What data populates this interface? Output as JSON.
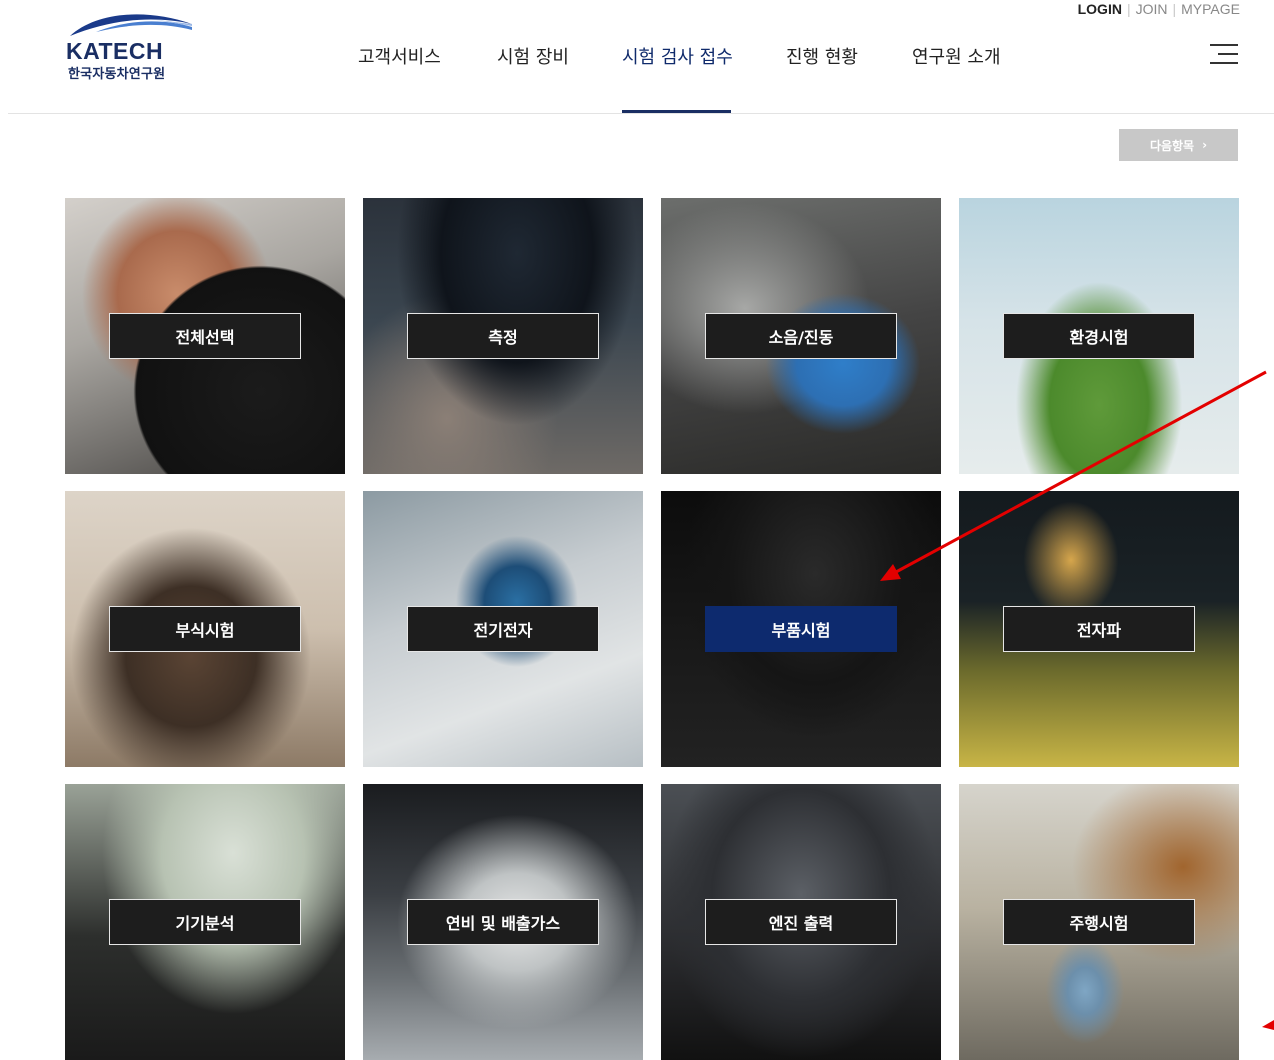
{
  "brand": {
    "name_en": "KATECH",
    "name_kr": "한국자동차연구원"
  },
  "util_nav": {
    "login": "LOGIN",
    "join": "JOIN",
    "mypage": "MYPAGE",
    "separator": "|"
  },
  "gnb": {
    "items": [
      {
        "label": "고객서비스"
      },
      {
        "label": "시험 장비"
      },
      {
        "label": "시험 검사 접수",
        "active": true
      },
      {
        "label": "진행 현황"
      },
      {
        "label": "연구원 소개"
      }
    ]
  },
  "menu_icon": "hamburger-menu-icon",
  "next_button": {
    "label": "다음항목",
    "icon": "chevron-right-icon",
    "chevron": "›"
  },
  "categories": [
    {
      "label": "전체선택"
    },
    {
      "label": "측정"
    },
    {
      "label": "소음/진동"
    },
    {
      "label": "환경시험"
    },
    {
      "label": "부식시험"
    },
    {
      "label": "전기전자"
    },
    {
      "label": "부품시험",
      "selected": true
    },
    {
      "label": "전자파"
    },
    {
      "label": "기기분석"
    },
    {
      "label": "연비 및 배출가스"
    },
    {
      "label": "엔진 출력"
    },
    {
      "label": "주행시험"
    }
  ],
  "colors": {
    "brand_navy": "#1a2e63",
    "selected_label": "#0d2a6e",
    "tile_label": "#1d1d1d",
    "next_button_bg": "#c8c8c8",
    "annotation_arrow": "#e30000"
  }
}
